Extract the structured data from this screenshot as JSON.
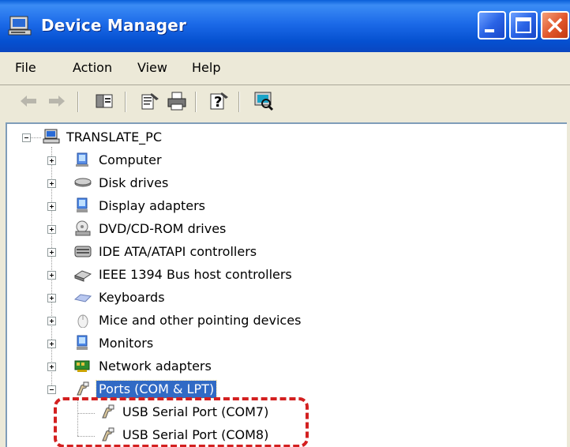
{
  "window": {
    "title": "Device Manager"
  },
  "menu": {
    "file": "File",
    "action": "Action",
    "view": "View",
    "help": "Help"
  },
  "toolbar": {
    "icons": [
      "back-arrow-icon",
      "forward-arrow-icon",
      "console-tree-icon",
      "properties-icon",
      "print-icon",
      "help-icon",
      "scan-hardware-icon"
    ]
  },
  "tree": {
    "root": "TRANSLATE_PC",
    "items": [
      {
        "label": "Computer"
      },
      {
        "label": "Disk drives"
      },
      {
        "label": "Display adapters"
      },
      {
        "label": "DVD/CD-ROM drives"
      },
      {
        "label": "IDE ATA/ATAPI controllers"
      },
      {
        "label": "IEEE 1394 Bus host controllers"
      },
      {
        "label": "Keyboards"
      },
      {
        "label": "Mice and other pointing devices"
      },
      {
        "label": "Monitors"
      },
      {
        "label": "Network adapters"
      },
      {
        "label": "Ports (COM & LPT)"
      }
    ],
    "ports_children": [
      {
        "label": "USB Serial Port (COM7)"
      },
      {
        "label": "USB Serial Port (COM8)"
      }
    ]
  },
  "colors": {
    "title_bar": "#0a56d8",
    "selection": "#316ac5",
    "highlight": "#d32020"
  }
}
